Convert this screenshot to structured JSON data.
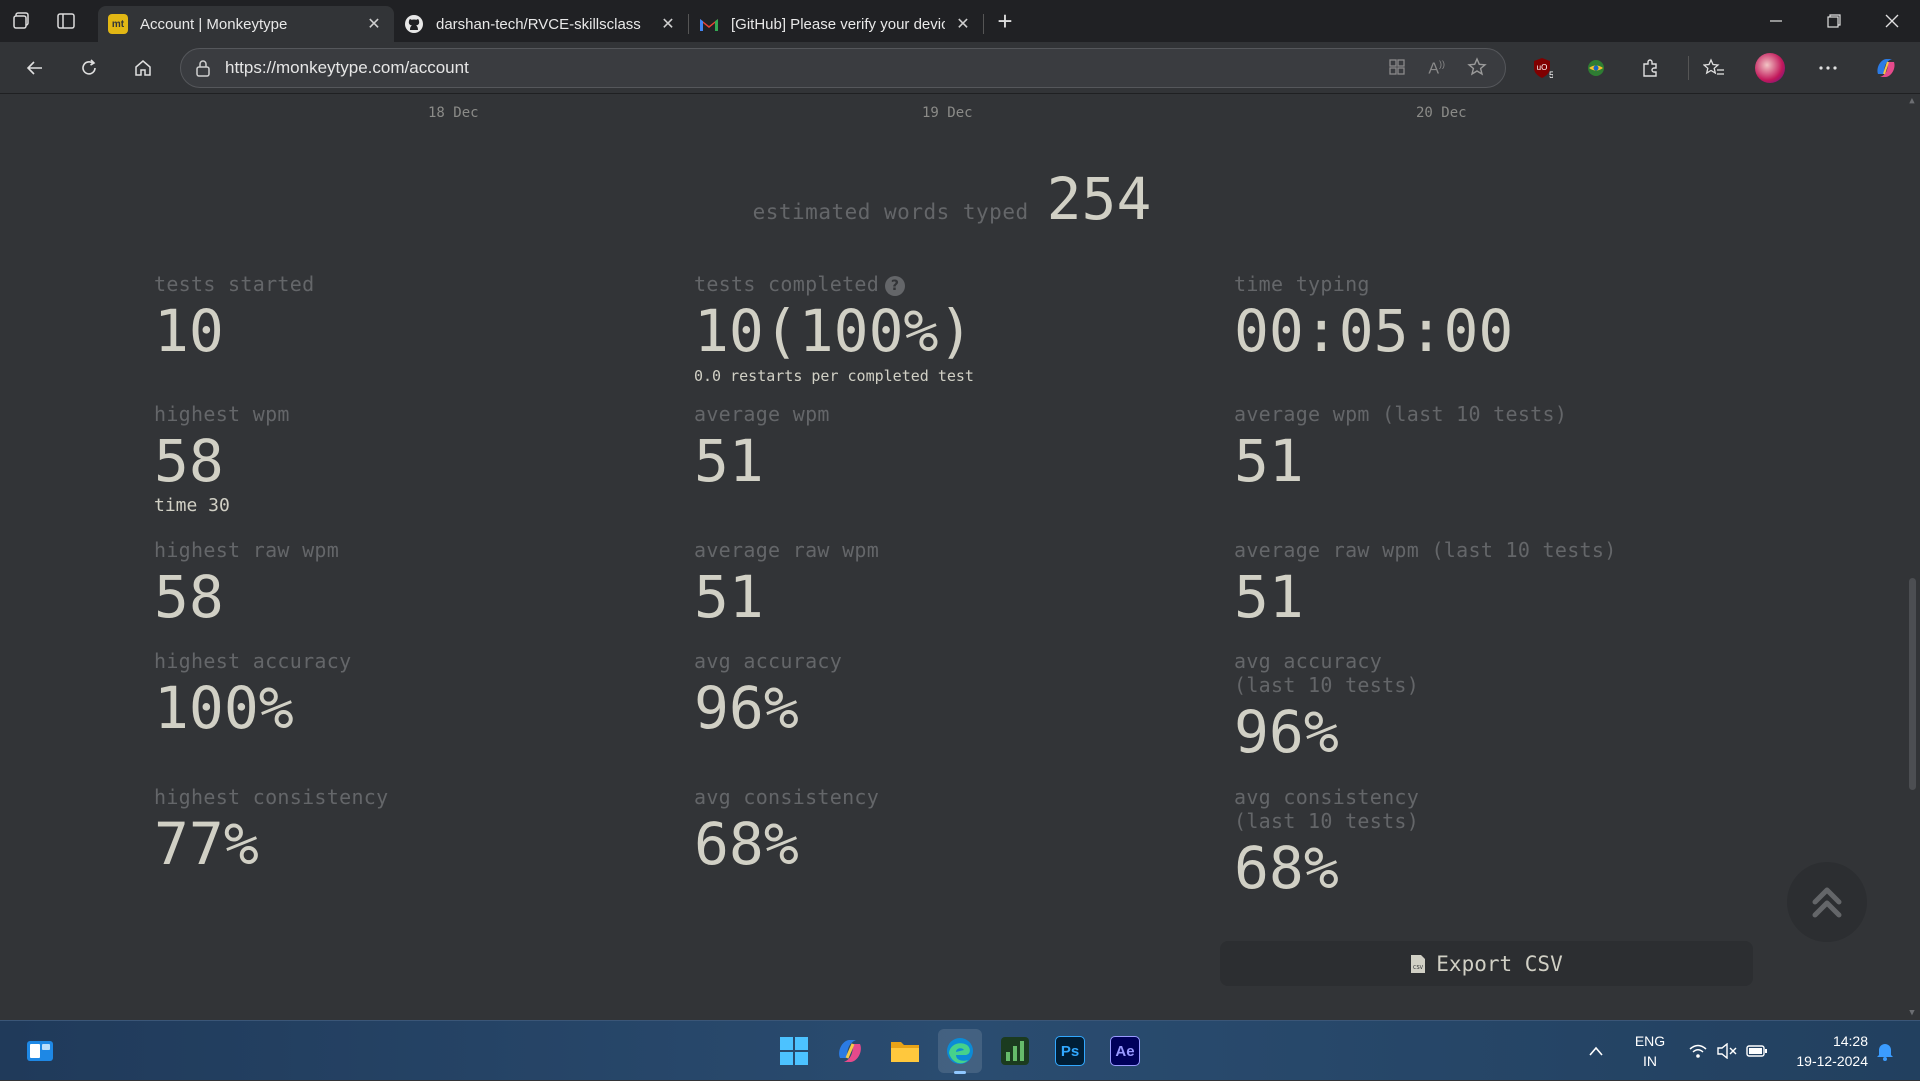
{
  "browser": {
    "tabs": [
      {
        "title": "Account | Monkeytype",
        "icon": "monkeytype-favicon",
        "favicon_text": "mt",
        "active": true
      },
      {
        "title": "darshan-tech/RVCE-skillsclass",
        "icon": "github-favicon",
        "active": false
      },
      {
        "title": "[GitHub] Please verify your device",
        "icon": "gmail-favicon",
        "active": false
      }
    ],
    "url": "https://monkeytype.com/account",
    "extension_badge": "5"
  },
  "chart_axis": {
    "ticks": [
      "18 Dec",
      "19 Dec",
      "20 Dec"
    ]
  },
  "estimated_words": {
    "label": "estimated words typed",
    "value": "254"
  },
  "stats": {
    "tests_started": {
      "label": "tests started",
      "value": "10"
    },
    "tests_completed": {
      "label": "tests completed",
      "value": "10(100%)",
      "sub": "0.0 restarts per completed test"
    },
    "time_typing": {
      "label": "time typing",
      "value": "00:05:00"
    },
    "highest_wpm": {
      "label": "highest wpm",
      "value": "58",
      "sub": "time 30"
    },
    "average_wpm": {
      "label": "average wpm",
      "value": "51"
    },
    "average_wpm_last10": {
      "label": "average wpm (last 10 tests)",
      "value": "51"
    },
    "highest_raw_wpm": {
      "label": "highest raw wpm",
      "value": "58"
    },
    "average_raw_wpm": {
      "label": "average raw wpm",
      "value": "51"
    },
    "average_raw_wpm_last10": {
      "label": "average raw wpm (last 10 tests)",
      "value": "51"
    },
    "highest_accuracy": {
      "label": "highest accuracy",
      "value": "100%"
    },
    "avg_accuracy": {
      "label": "avg accuracy",
      "value": "96%"
    },
    "avg_accuracy_last10": {
      "label_line1": "avg accuracy",
      "label_line2": "(last 10 tests)",
      "value": "96%"
    },
    "highest_consistency": {
      "label": "highest consistency",
      "value": "77%"
    },
    "avg_consistency": {
      "label": "avg consistency",
      "value": "68%"
    },
    "avg_consistency_last10": {
      "label_line1": "avg consistency",
      "label_line2": "(last 10 tests)",
      "value": "68%"
    }
  },
  "export_button": {
    "label": "Export CSV"
  },
  "taskbar": {
    "apps": [
      "start-icon",
      "copilot-icon",
      "file-explorer-icon",
      "edge-icon",
      "task-manager-icon",
      "photoshop-icon",
      "after-effects-icon"
    ],
    "photoshop_label": "Ps",
    "after_effects_label": "Ae",
    "lang_line1": "ENG",
    "lang_line2": "IN",
    "time": "14:28",
    "date": "19-12-2024"
  }
}
